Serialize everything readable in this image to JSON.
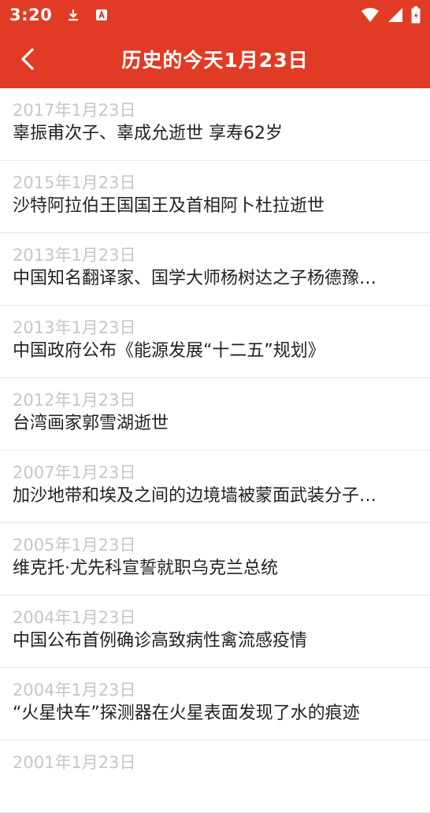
{
  "status": {
    "time": "3:20"
  },
  "appbar": {
    "title": "历史的今天1月23日"
  },
  "colors": {
    "primary": "#e23b25",
    "date": "#c6c6c6",
    "text": "#222222"
  },
  "events": [
    {
      "date": "2017年1月23日",
      "title": "辜振甫次子、辜成允逝世  享寿62岁"
    },
    {
      "date": "2015年1月23日",
      "title": "沙特阿拉伯王国国王及首相阿卜杜拉逝世"
    },
    {
      "date": "2013年1月23日",
      "title": "中国知名翻译家、国学大师杨树达之子杨德豫…"
    },
    {
      "date": "2013年1月23日",
      "title": "中国政府公布《能源发展“十二五”规划》"
    },
    {
      "date": "2012年1月23日",
      "title": "台湾画家郭雪湖逝世"
    },
    {
      "date": "2007年1月23日",
      "title": "加沙地带和埃及之间的边境墙被蒙面武装分子…"
    },
    {
      "date": "2005年1月23日",
      "title": "维克托·尤先科宣誓就职乌克兰总统"
    },
    {
      "date": "2004年1月23日",
      "title": "中国公布首例确诊高致病性禽流感疫情"
    },
    {
      "date": "2004年1月23日",
      "title": "“火星快车”探测器在火星表面发现了水的痕迹"
    },
    {
      "date": "2001年1月23日",
      "title": ""
    }
  ]
}
